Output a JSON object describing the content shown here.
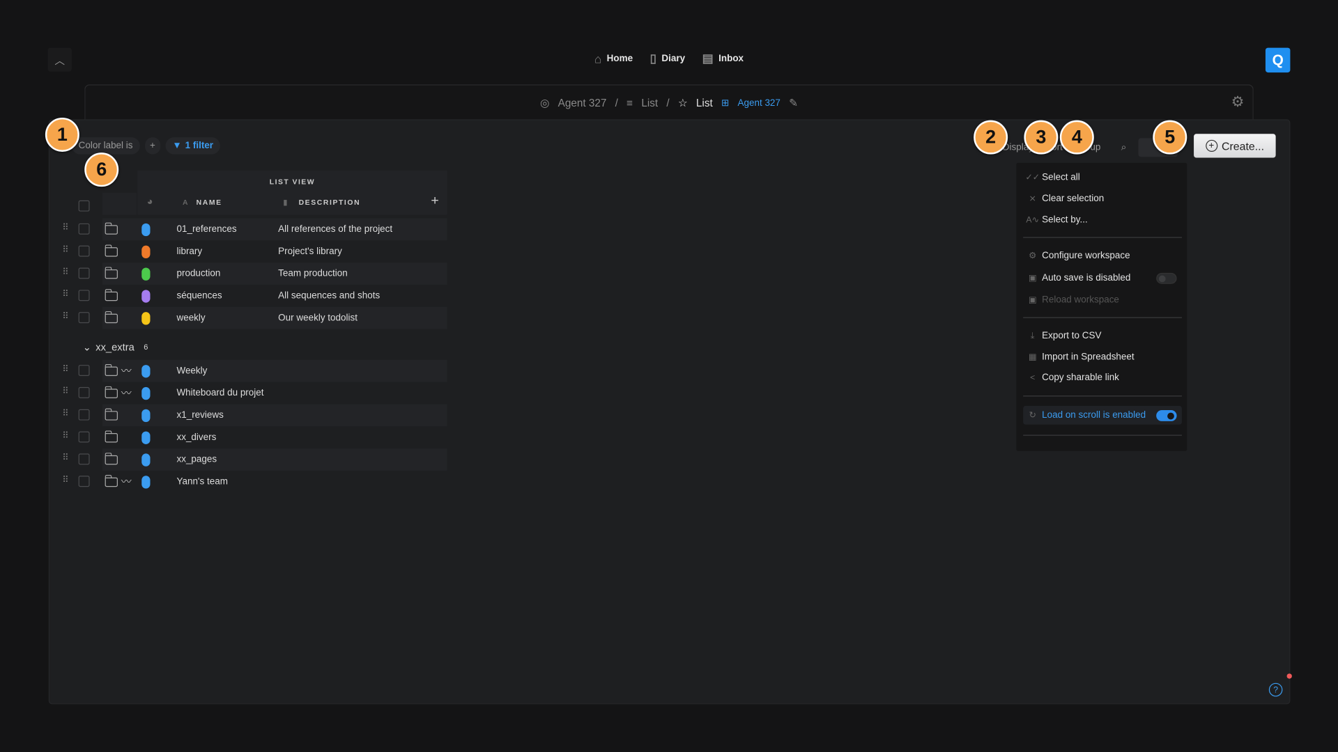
{
  "nav": {
    "items": [
      {
        "label": "Home",
        "icon": "home-icon"
      },
      {
        "label": "Diary",
        "icon": "book-icon"
      },
      {
        "label": "Inbox",
        "icon": "chat-icon"
      }
    ]
  },
  "breadcrumb": {
    "project": "Agent 327",
    "list1": "List",
    "current": "List",
    "workspace": "Agent 327"
  },
  "filters": {
    "chip": "Color label is",
    "count": "1 filter"
  },
  "toolbar": {
    "display": "Display",
    "sort": "Sort",
    "group": "Group",
    "create": "Create..."
  },
  "table": {
    "view_title": "LIST VIEW",
    "columns": [
      "NAME",
      "DESCRIPTION"
    ],
    "rows": [
      {
        "name": "01_references",
        "description": "All references of the project",
        "color": "#3b9cf0"
      },
      {
        "name": "library",
        "description": "Project's library",
        "color": "#f07a2a"
      },
      {
        "name": "production",
        "description": "Team production",
        "color": "#4cc94c"
      },
      {
        "name": "séquences",
        "description": "All sequences and shots",
        "color": "#a57df0"
      },
      {
        "name": "weekly",
        "description": "Our weekly todolist",
        "color": "#f5c518"
      }
    ],
    "group": {
      "name": "xx_extra",
      "count": "6",
      "rows": [
        {
          "name": "Weekly",
          "color": "#3b9cf0",
          "trend": true
        },
        {
          "name": "Whiteboard du projet",
          "color": "#3b9cf0",
          "trend": true
        },
        {
          "name": "x1_reviews",
          "color": "#3b9cf0",
          "trend": false
        },
        {
          "name": "xx_divers",
          "color": "#3b9cf0",
          "trend": false
        },
        {
          "name": "xx_pages",
          "color": "#3b9cf0",
          "trend": false
        },
        {
          "name": "Yann's team",
          "color": "#3b9cf0",
          "trend": true
        }
      ]
    }
  },
  "menu": {
    "items": [
      "Select all",
      "Clear selection",
      "Select by...",
      "Configure workspace",
      "Auto save is disabled",
      "Reload workspace",
      "Export to CSV",
      "Import in Spreadsheet",
      "Copy sharable link",
      "Load on scroll is enabled"
    ],
    "auto_save": false,
    "load_on_scroll": true
  },
  "callouts": [
    "1",
    "2",
    "3",
    "4",
    "5",
    "6"
  ],
  "colors": {
    "accent": "#3b9cf0",
    "callout": "#f6a54b"
  }
}
